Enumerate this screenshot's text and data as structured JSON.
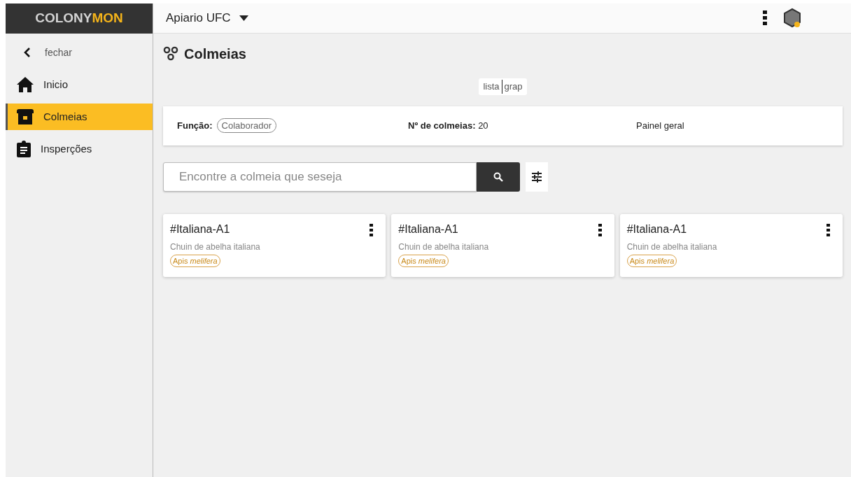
{
  "brand": {
    "part_1": "COLONY",
    "part_2": "MON"
  },
  "apiary": {
    "name": "Apiario UFC"
  },
  "sidebar": {
    "close": "fechar",
    "items": [
      {
        "label": "Inicio",
        "kind": "home",
        "selected": false
      },
      {
        "label": "Colmeias",
        "kind": "hive",
        "selected": true
      },
      {
        "label": "Insperções",
        "kind": "clipboard",
        "selected": false
      }
    ]
  },
  "page": {
    "title": "Colmeias"
  },
  "view_toggle": [
    "lista",
    "grap"
  ],
  "summary": {
    "role_label": "Função:",
    "role": "Colaborador",
    "count_label": "Nº de colmeias:",
    "count": "20",
    "panel": "Painel geral"
  },
  "search": {
    "placeholder": "Encontre a colmeia que seseja"
  },
  "hives": [
    {
      "name": "#Italiana-A1",
      "description": "Chuin de abelha italiana",
      "tag": "Apis *melifera*"
    },
    {
      "name": "#Italiana-A1",
      "description": "Chuin de abelha italiana",
      "tag": "Apis *melifera*"
    },
    {
      "name": "#Italiana-A1",
      "description": "Chuin de abelha italiana",
      "tag": "Apis *melifera*"
    }
  ]
}
